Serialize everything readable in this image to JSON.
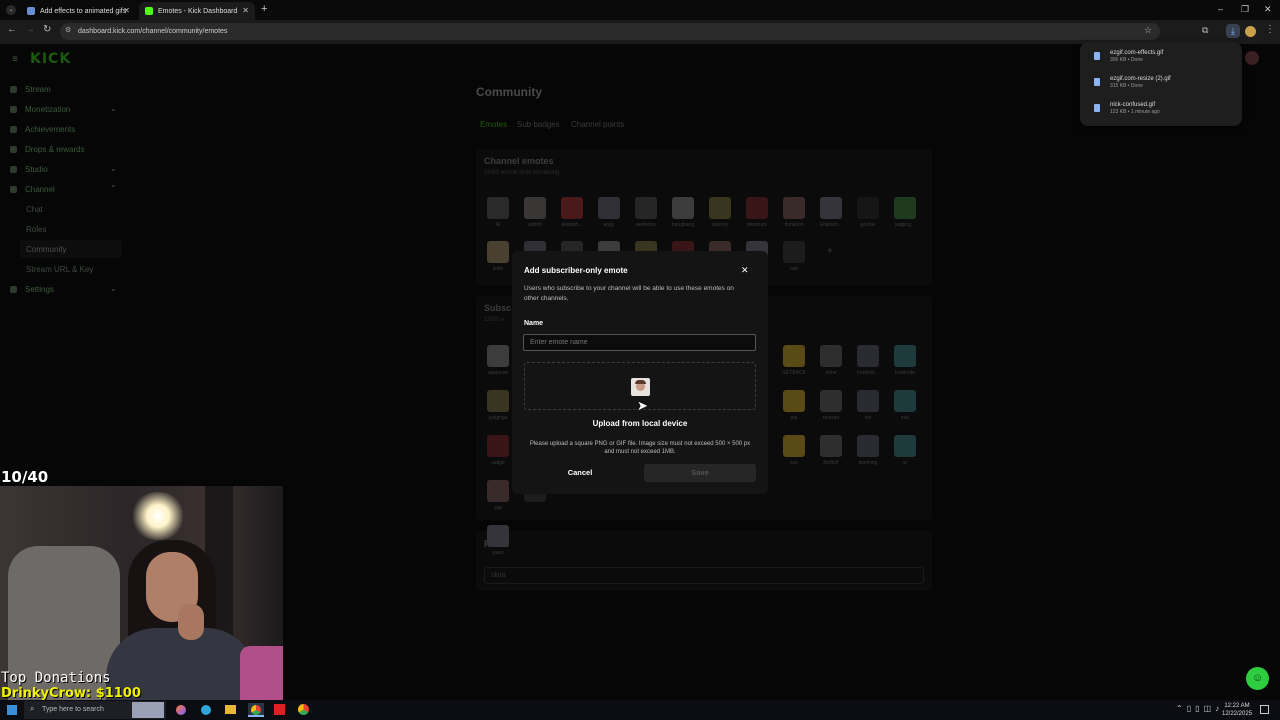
{
  "browser": {
    "tabs": [
      {
        "title": "Add effects to animated gifs"
      },
      {
        "title": "Emotes - Kick Dashboard"
      }
    ],
    "url": "dashboard.kick.com/channel/community/emotes"
  },
  "downloads": [
    {
      "name": "ezgif.com-effects.gif",
      "meta": "306 KB • Done"
    },
    {
      "name": "ezgif.com-resize (2).gif",
      "meta": "315 KB • Done"
    },
    {
      "name": "nick-confused.gif",
      "meta": "123 KB • 1 minute ago"
    }
  ],
  "sidebar": {
    "logo": "KICK",
    "items": [
      {
        "label": "Stream"
      },
      {
        "label": "Monetization"
      },
      {
        "label": "Achievements"
      },
      {
        "label": "Drops & rewards"
      },
      {
        "label": "Studio"
      },
      {
        "label": "Channel"
      },
      {
        "label": "Chat"
      },
      {
        "label": "Roles"
      },
      {
        "label": "Community"
      },
      {
        "label": "Stream URL & Key"
      },
      {
        "label": "Settings"
      }
    ]
  },
  "main": {
    "title": "Community",
    "tabs": [
      "Emotes",
      "Sub badges",
      "Channel points"
    ],
    "channel_emotes": {
      "heading": "Channel emotes",
      "sub": "39/60 emote slots remaining",
      "row1": [
        "4k",
        "ahhhh",
        "alertath...",
        "angy",
        "awhelms",
        "bangbang",
        "dancey",
        "deeznuts",
        "dunkdon",
        "Elijahuh...",
        "goobie",
        "judging..."
      ],
      "row2": [
        "knife",
        "wat"
      ]
    },
    "sub_emotes": {
      "heading": "Subsc",
      "sub": "22/60 e",
      "left_labels": [
        "applause",
        "judgingu",
        "sadge",
        "yap",
        "yawn"
      ],
      "right_row1": [
        "GETBACK",
        "hehe",
        "hotdrink...",
        "lookknife"
      ],
      "right_row2": [
        "pat",
        "relaxed",
        "ritz",
        "sad"
      ],
      "right_row3": [
        "sus",
        "theftoff",
        "twerking",
        "w"
      ]
    },
    "prefix": {
      "heading": "Prefix",
      "value": "skira"
    }
  },
  "modal": {
    "title": "Add subscriber-only emote",
    "description": "Users who subscribe to your channel will be able to use these emotes on other channels.",
    "name_label": "Name",
    "name_placeholder": "Enter emote name",
    "upload_label": "Upload from local device",
    "upload_hint": "Please upload a square PNG or GIF file. Image size must not exceed 500 × 500 px and must not exceed 1MB.",
    "cancel_label": "Cancel",
    "save_label": "Save"
  },
  "overlay": {
    "counter": "10/40",
    "donations_title": "Top Donations",
    "donations_top": "DrinkyCrow: $1100"
  },
  "taskbar": {
    "search_placeholder": "Type here to search",
    "time": "12:22 AM",
    "date": "12/22/2025"
  },
  "colors": {
    "kick_green": "#53fc18",
    "modal_bg": "#141414"
  }
}
